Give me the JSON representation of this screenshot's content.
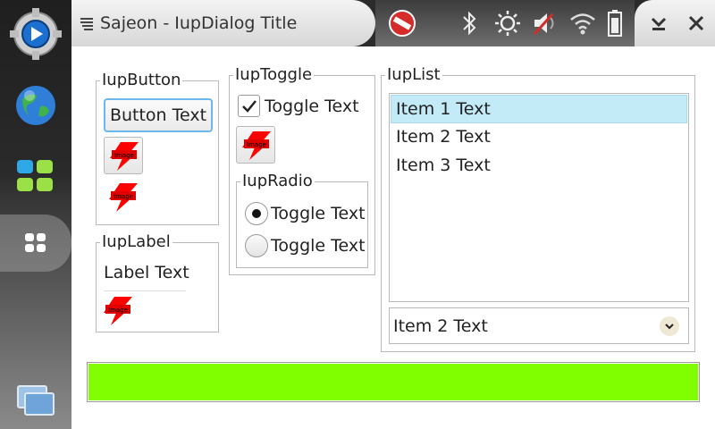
{
  "window": {
    "title": "Sajeon - IupDialog Title"
  },
  "sidebar": {
    "items": [
      {
        "icon": "media-player-icon"
      },
      {
        "icon": "globe-icon"
      },
      {
        "icon": "apps-grid-icon"
      },
      {
        "icon": "dashboard-icon"
      },
      {
        "icon": "task-switcher-icon"
      }
    ]
  },
  "status_icons": [
    "no-entry-icon",
    "bluetooth-icon",
    "brightness-icon",
    "volume-muted-icon",
    "wifi-icon",
    "battery-icon"
  ],
  "colors": {
    "progress": "#80ff00",
    "list_selection": "#c2ebf7"
  },
  "button_frame": {
    "title": "IupButton",
    "text_button": "Button Text",
    "image_button_text": "Image",
    "flat_image_text": "Image"
  },
  "label_frame": {
    "title": "IupLabel",
    "label": "Label Text",
    "image_text": "Image"
  },
  "toggle_frame": {
    "title": "IupToggle",
    "toggle_label": "Toggle Text",
    "toggle_checked": true,
    "image_text": "Image"
  },
  "radio_frame": {
    "title": "IupRadio",
    "options": [
      {
        "label": "Toggle Text",
        "selected": true
      },
      {
        "label": "Toggle Text",
        "selected": false
      }
    ]
  },
  "list_frame": {
    "title": "IupList",
    "items": [
      "Item 1 Text",
      "Item 2 Text",
      "Item 3 Text"
    ],
    "selected_index": 0,
    "dropdown_value": "Item 2 Text"
  },
  "progress": {
    "value": 1.0
  }
}
